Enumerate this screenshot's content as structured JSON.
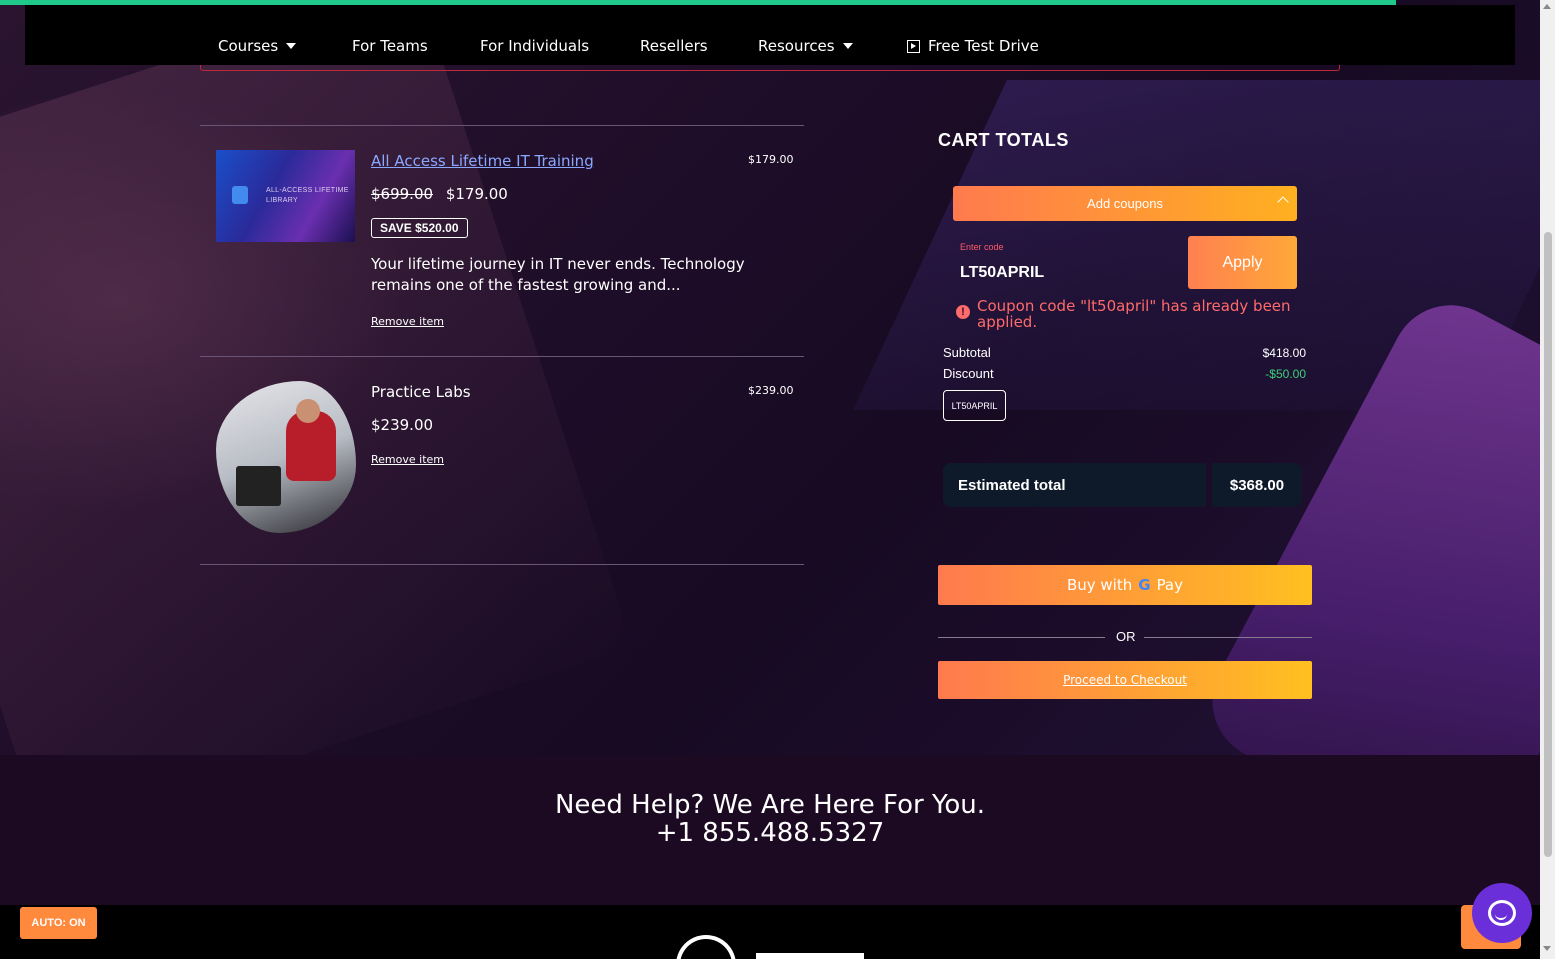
{
  "nav": {
    "items": [
      {
        "label": "Courses",
        "has_caret": true
      },
      {
        "label": "For Teams",
        "has_caret": false
      },
      {
        "label": "For Individuals",
        "has_caret": false
      },
      {
        "label": "Resellers",
        "has_caret": false
      },
      {
        "label": "Resources",
        "has_caret": true
      },
      {
        "label": "Free Test Drive",
        "icon": "play-square-icon"
      }
    ]
  },
  "cart": {
    "items": [
      {
        "thumb_text": "ALL-ACCESS LIFETIME LIBRARY",
        "title": "All Access Lifetime IT Training",
        "original_price": "$699.00",
        "price": "$179.00",
        "save_badge": "SAVE $520.00",
        "description": "Your lifetime journey in IT never ends. Technology remains one of the fastest growing and...",
        "remove_label": "Remove item",
        "line_total": "$179.00"
      },
      {
        "title": "Practice Labs",
        "price": "$239.00",
        "remove_label": "Remove item",
        "line_total": "$239.00"
      }
    ]
  },
  "totals": {
    "title": "CART TOTALS",
    "coupon_toggle_label": "Add coupons",
    "code_label": "Enter code",
    "code_value": "LT50APRIL",
    "apply_label": "Apply",
    "error_message": "Coupon code \"lt50april\" has already been applied.",
    "subtotal_label": "Subtotal",
    "subtotal_value": "$418.00",
    "discount_label": "Discount",
    "discount_value": "-$50.00",
    "applied_coupon": "LT50APRIL",
    "estimated_label": "Estimated total",
    "estimated_value": "$368.00",
    "gpay_label": "Buy with",
    "gpay_brand": "Pay",
    "or_label": "OR",
    "checkout_label": "Proceed to Checkout"
  },
  "help": {
    "title": "Need Help? We Are Here For You.",
    "phone": "+1 855.488.5327"
  },
  "footer": {
    "auto_badge": "AUTO: ON"
  },
  "colors": {
    "accent_green": "#1fc98a",
    "brand_orange": "#ff7a4e",
    "brand_yellow": "#ffc020",
    "error_red": "#ff6a6a",
    "discount_green": "#3ccf7a",
    "chat_purple": "#6a2fd8"
  }
}
